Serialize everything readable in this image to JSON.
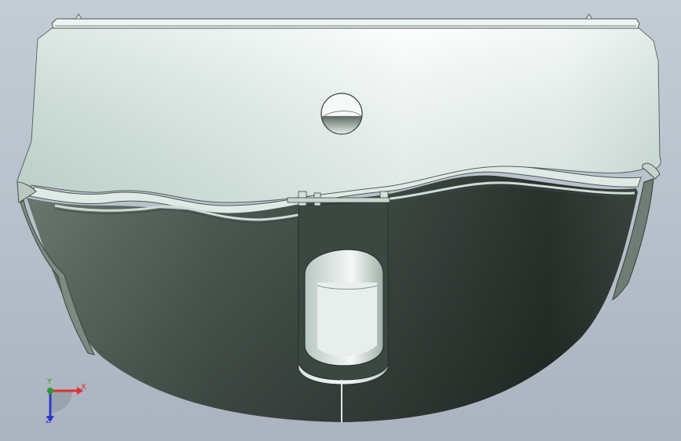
{
  "viewport": {
    "background_top": "#c4ccd6",
    "background_bottom": "#aab3bf"
  },
  "model": {
    "cap_color_light": "#f6fbf8",
    "cap_color_shadow": "#b9cdc5",
    "body_color_dark": "#2c342f",
    "body_color_mid": "#5d6a62",
    "icon": "curved-housing-part"
  },
  "triad": {
    "x_label": "X",
    "y_label": "Y",
    "z_label": "Z",
    "x_color": "#e03030",
    "y_color": "#2a9a2a",
    "z_color": "#2a3acc"
  }
}
